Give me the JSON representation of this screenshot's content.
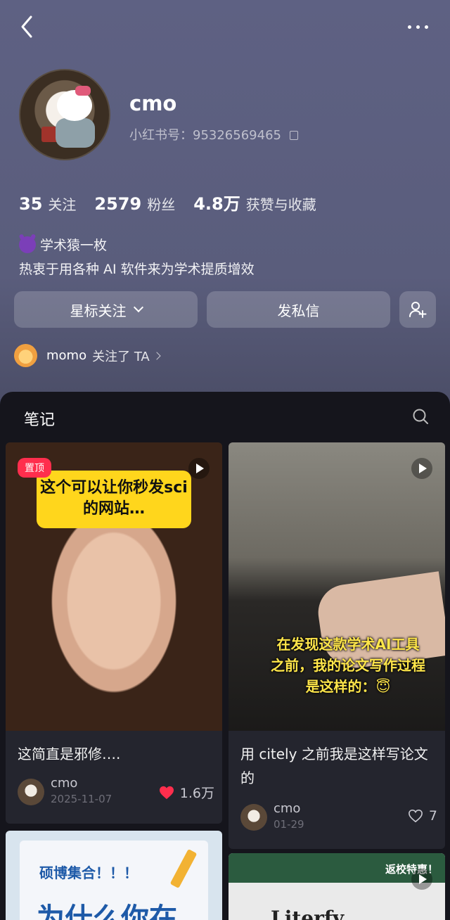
{
  "header": {
    "back_icon": "chevron-left-icon",
    "more_icon": "more-dots-icon"
  },
  "profile": {
    "name": "cmo",
    "id_label": "小红书号：95326569465",
    "stats": [
      {
        "value": "35",
        "label": "关注"
      },
      {
        "value": "2579",
        "label": "粉丝"
      },
      {
        "value": "4.8万",
        "label": "获赞与收藏"
      }
    ],
    "bio_line1": "学术猿一枚",
    "bio_line2": "热衷于用各种 AI 软件来为学术提质增效"
  },
  "actions": {
    "star_follow": "星标关注",
    "message": "发私信",
    "add_friend_icon": "add-user-icon"
  },
  "followed_by": {
    "name": "momo",
    "text": "关注了 TA"
  },
  "notes_panel": {
    "title": "笔记",
    "search_icon": "search-icon",
    "cards": [
      {
        "pinned_label": "置顶",
        "overlay": "这个可以让你秒发sci的网站…",
        "title": "这简直是邪修….",
        "author": "cmo",
        "date": "2025-11-07",
        "likes": "1.6万",
        "liked": true
      },
      {
        "overlay": "在发现这款学术AI工具之前，我的论文写作过程是这样的：😇",
        "title": "用 citely 之前我是这样写论文的",
        "author": "cmo",
        "date": "01-29",
        "likes": "7",
        "liked": false
      },
      {
        "overlay_small": "硕博集合！！！",
        "overlay_big": "为什么你在"
      },
      {
        "overlay_tag": "返校特惠！",
        "overlay_logo": "Literfy"
      }
    ]
  },
  "colors": {
    "accent_red": "#ff2e4d",
    "caption_yellow": "#ffd61c",
    "panel_bg": "#15151c"
  }
}
